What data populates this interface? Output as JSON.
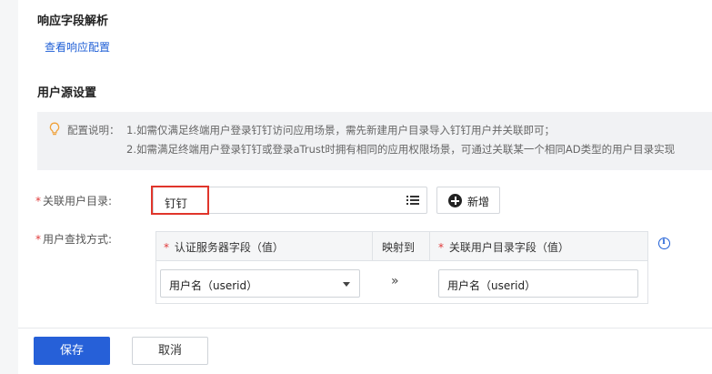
{
  "response_section": {
    "title": "响应字段解析",
    "view_config_link": "查看响应配置"
  },
  "user_source_section": {
    "title": "用户源设置",
    "note": {
      "label": "配置说明：",
      "line1": "1.如需仅满足终端用户登录钉钉访问应用场景，需先新建用户目录导入钉钉用户并关联即可；",
      "line2": "2.如需满足终端用户登录钉钉或登录aTrust时拥有相同的应用权限场景，可通过关联某一个相同AD类型的用户目录实现",
      "icon": "lightbulb-icon",
      "icon_color": "#f0a13a"
    },
    "directory_field": {
      "required_mark": "*",
      "label": "关联用户目录:",
      "value": "钉钉",
      "add_button_label": "新增"
    },
    "lookup_field": {
      "required_mark": "*",
      "label": "用户查找方式:",
      "table": {
        "headers": {
          "auth_field": "认证服务器字段（值）",
          "maps_to": "映射到",
          "dir_field": "关联用户目录字段（值）"
        },
        "row": {
          "auth_value": "用户名（userid）",
          "arrow": "»",
          "dir_value": "用户名（userid）"
        }
      }
    }
  },
  "footer": {
    "save_label": "保存",
    "cancel_label": "取消"
  },
  "colors": {
    "primary": "#2660d8",
    "link": "#1f5fd6",
    "required": "#e03a3a",
    "highlight_border": "#e0352b"
  }
}
